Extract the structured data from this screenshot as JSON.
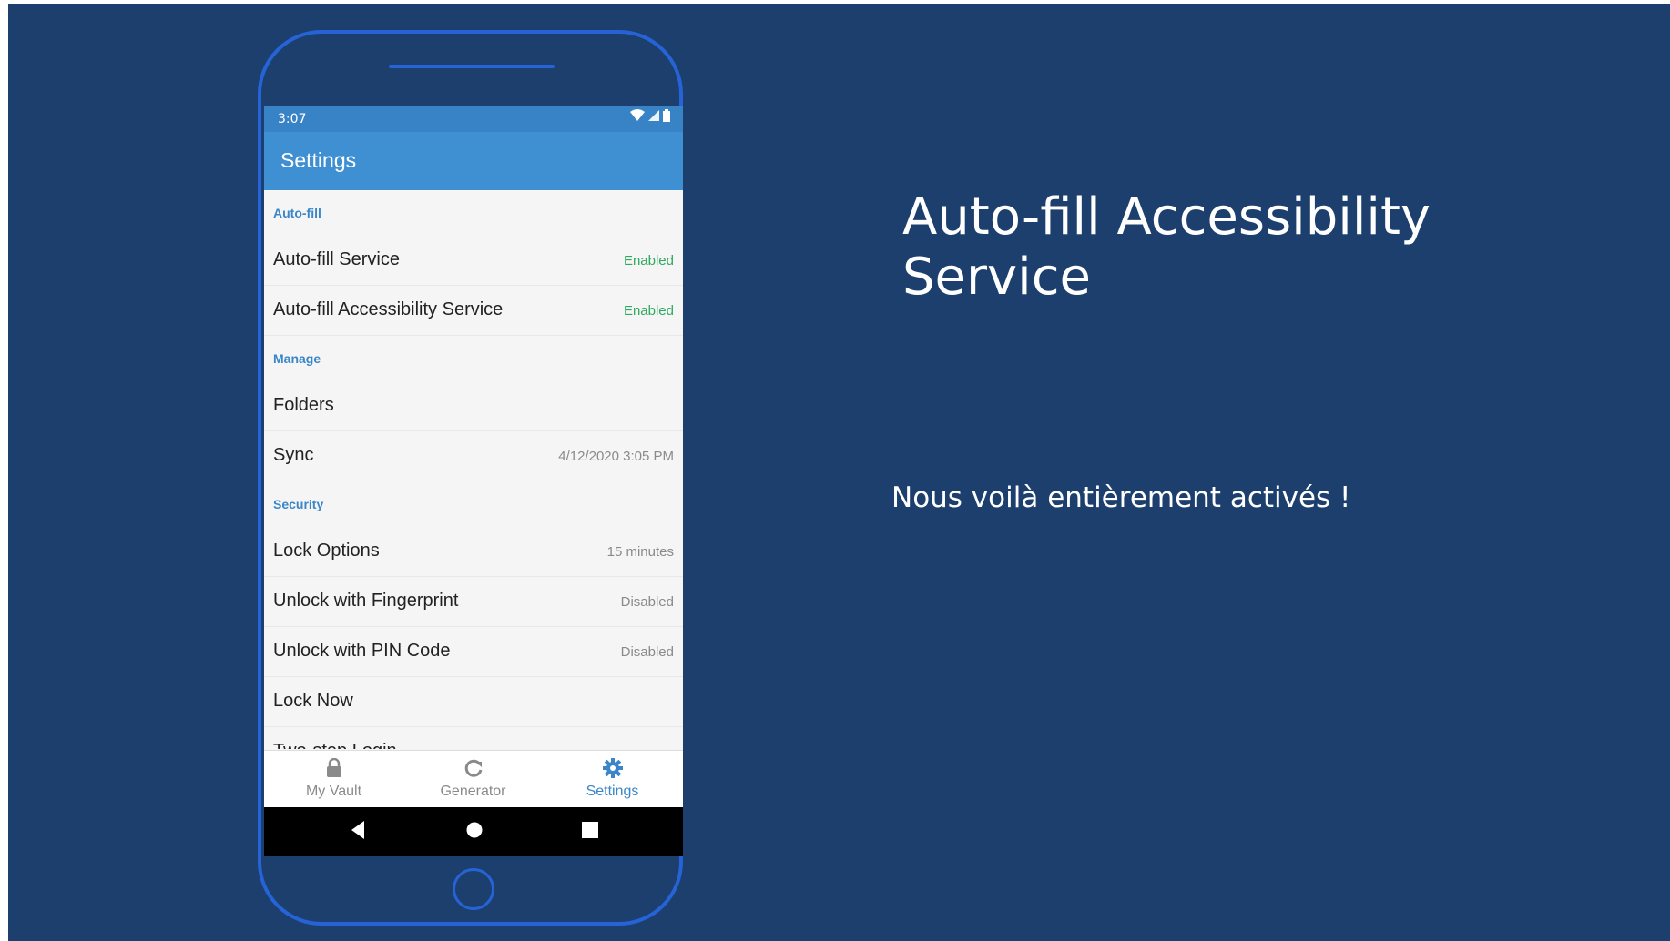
{
  "slide": {
    "heading": "Auto-fill Accessibility Service",
    "subtext": "Nous voilà entièrement activés !"
  },
  "phone": {
    "status_time": "3:07",
    "app_title": "Settings",
    "sections": [
      {
        "header": "Auto-fill",
        "rows": [
          {
            "label": "Auto-fill Service",
            "value": "Enabled",
            "value_color": "#2eaa5f"
          },
          {
            "label": "Auto-fill Accessibility Service",
            "value": "Enabled",
            "value_color": "#2eaa5f"
          }
        ]
      },
      {
        "header": "Manage",
        "rows": [
          {
            "label": "Folders",
            "value": ""
          },
          {
            "label": "Sync",
            "value": "4/12/2020 3:05 PM"
          }
        ]
      },
      {
        "header": "Security",
        "rows": [
          {
            "label": "Lock Options",
            "value": "15 minutes"
          },
          {
            "label": "Unlock with Fingerprint",
            "value": "Disabled"
          },
          {
            "label": "Unlock with PIN Code",
            "value": "Disabled"
          },
          {
            "label": "Lock Now",
            "value": ""
          },
          {
            "label": "Two-step Login",
            "value": ""
          }
        ]
      }
    ],
    "bottom_nav": [
      {
        "label": "My Vault",
        "icon": "lock-icon",
        "active": false
      },
      {
        "label": "Generator",
        "icon": "refresh-icon",
        "active": false
      },
      {
        "label": "Settings",
        "icon": "gear-icon",
        "active": true
      }
    ],
    "system_nav": [
      "back-icon",
      "home-icon",
      "recents-icon"
    ]
  },
  "colors": {
    "background": "#1c3f6e",
    "frame": "#2563d6",
    "appbar": "#3f90d3",
    "accent": "#3a86c8",
    "enabled": "#2eaa5f"
  }
}
